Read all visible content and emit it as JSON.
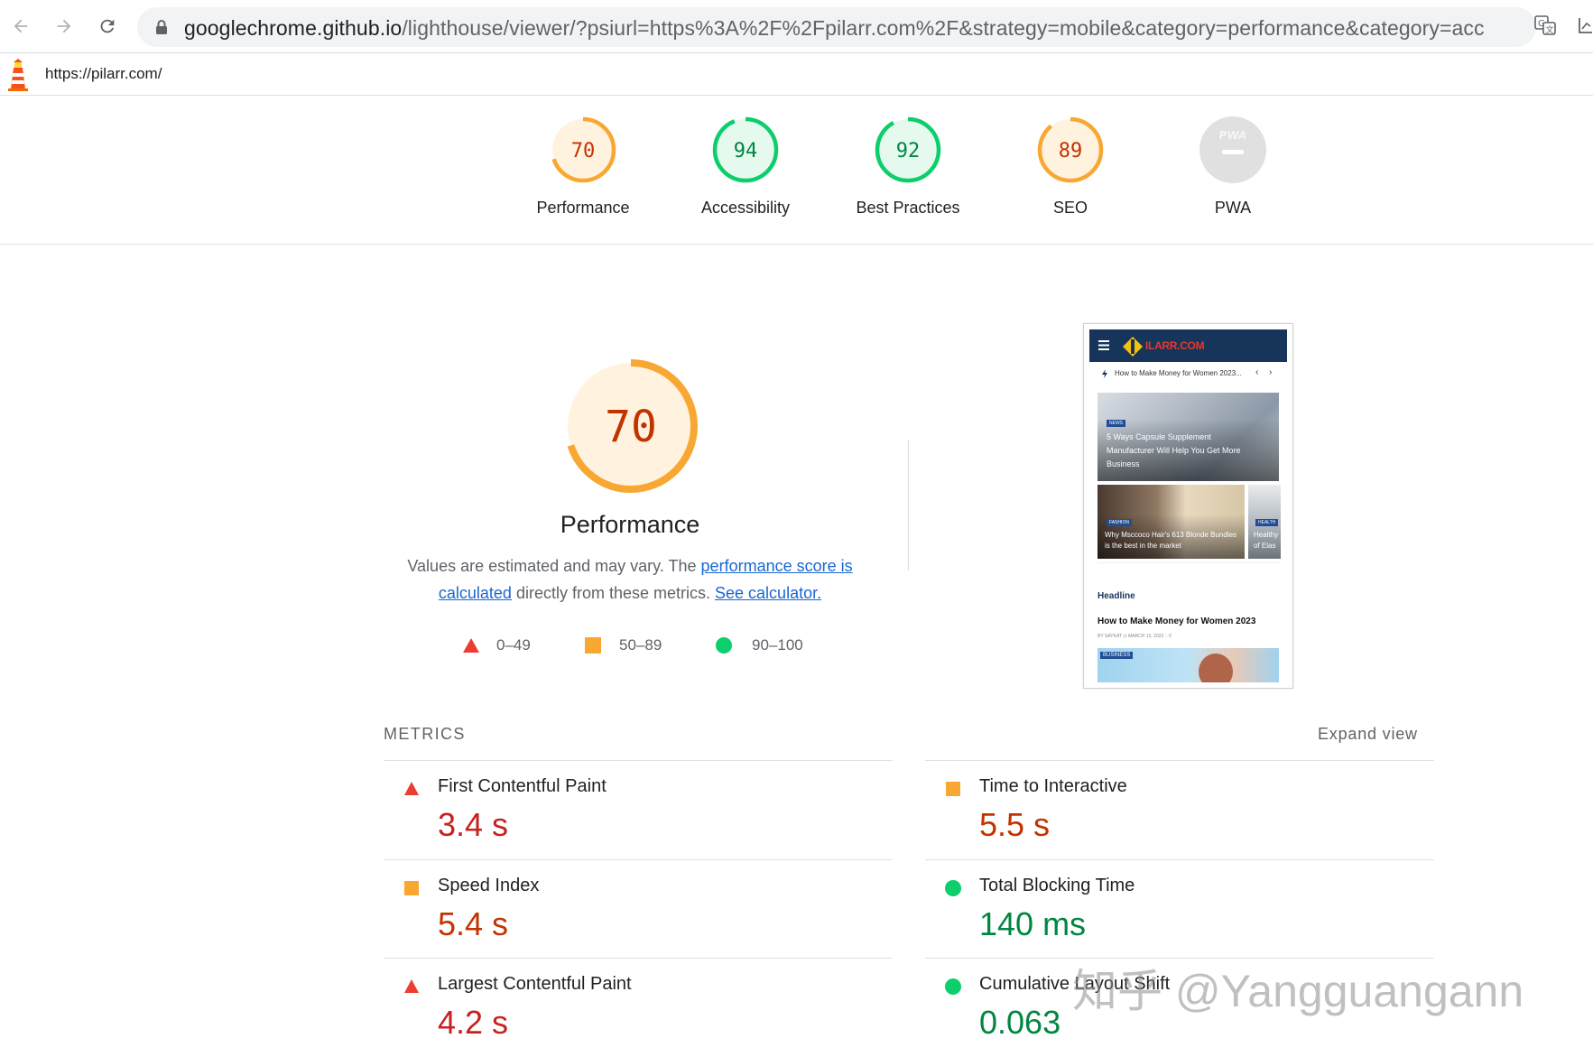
{
  "browser": {
    "url_host": "googlechrome.github.io",
    "url_rest": "/lighthouse/viewer/?psiurl=https%3A%2F%2Fpilarr.com%2F&strategy=mobile&category=performance&category=acces..."
  },
  "lighthouse": {
    "page_url": "https://pilarr.com/"
  },
  "categories": [
    {
      "label": "Performance",
      "score": "70",
      "rating": "average"
    },
    {
      "label": "Accessibility",
      "score": "94",
      "rating": "pass"
    },
    {
      "label": "Best Practices",
      "score": "92",
      "rating": "pass"
    },
    {
      "label": "SEO",
      "score": "89",
      "rating": "average"
    },
    {
      "label": "PWA",
      "score": "",
      "rating": "na"
    }
  ],
  "performance": {
    "score": "70",
    "title": "Performance",
    "desc_prefix": "Values are estimated and may vary. The ",
    "link_score": "performance score is calculated",
    "desc_middle": " directly from these metrics. ",
    "link_calculator": "See calculator.",
    "legend": {
      "fail": "0–49",
      "average": "50–89",
      "pass": "90–100"
    }
  },
  "thumbnail": {
    "brand": "ILARR.COM",
    "ticker": "How to Make Money for Women 2023...",
    "hero_tag": "NEWS",
    "hero_caption": "5 Ways Capsule Supplement Manufacturer Will Help You Get More Business",
    "card1_tag": "FASHION",
    "card1_caption": "Why Msccoco Hair's 613 Blonde Bundles is the best in the market",
    "card2_tag": "HEALTH",
    "card2_caption": "Healthy of Elas",
    "section": "Headline",
    "article": "How to Make Money for Women 2023",
    "meta": "BY SAYKAT  ◷ MARCH 13, 2023  ◌ 0",
    "bottom_tag": "BUSINESS"
  },
  "metrics": {
    "title": "METRICS",
    "expand": "Expand view",
    "items": [
      {
        "label": "First Contentful Paint",
        "value": "3.4 s",
        "rating": "fail"
      },
      {
        "label": "Time to Interactive",
        "value": "5.5 s",
        "rating": "average"
      },
      {
        "label": "Speed Index",
        "value": "5.4 s",
        "rating": "average"
      },
      {
        "label": "Total Blocking Time",
        "value": "140 ms",
        "rating": "pass"
      },
      {
        "label": "Largest Contentful Paint",
        "value": "4.2 s",
        "rating": "fail"
      },
      {
        "label": "Cumulative Layout Shift",
        "value": "0.063",
        "rating": "pass"
      }
    ]
  },
  "watermark": "知乎 @Yangguangann",
  "colors": {
    "fail": "#eb3d32",
    "fail_text": "#c5221f",
    "average": "#f8a733",
    "average_text": "#c33300",
    "pass": "#0cce6b",
    "pass_text": "#018642",
    "na": "#e0e0e0"
  }
}
